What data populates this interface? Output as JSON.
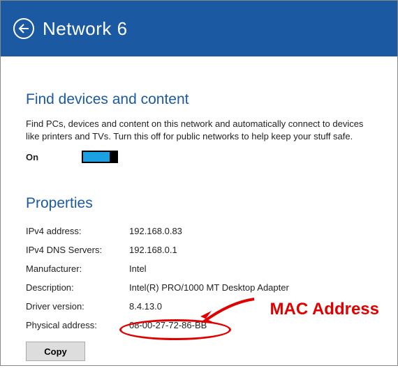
{
  "header": {
    "title": "Network  6"
  },
  "find": {
    "heading": "Find devices and content",
    "description": "Find PCs, devices and content on this network and automatically connect to devices like printers and TVs. Turn this off for public networks to help keep your stuff safe.",
    "toggle_state": "On"
  },
  "properties": {
    "heading": "Properties",
    "rows": [
      {
        "label": "IPv4 address:",
        "value": "192.168.0.83"
      },
      {
        "label": "IPv4 DNS Servers:",
        "value": "192.168.0.1"
      },
      {
        "label": "Manufacturer:",
        "value": "Intel"
      },
      {
        "label": "Description:",
        "value": "Intel(R) PRO/1000 MT Desktop Adapter"
      },
      {
        "label": "Driver version:",
        "value": "8.4.13.0"
      },
      {
        "label": "Physical address:",
        "value": "08-00-27-72-86-BB"
      }
    ],
    "copy_label": "Copy"
  },
  "annotation": {
    "label": "MAC Address"
  }
}
